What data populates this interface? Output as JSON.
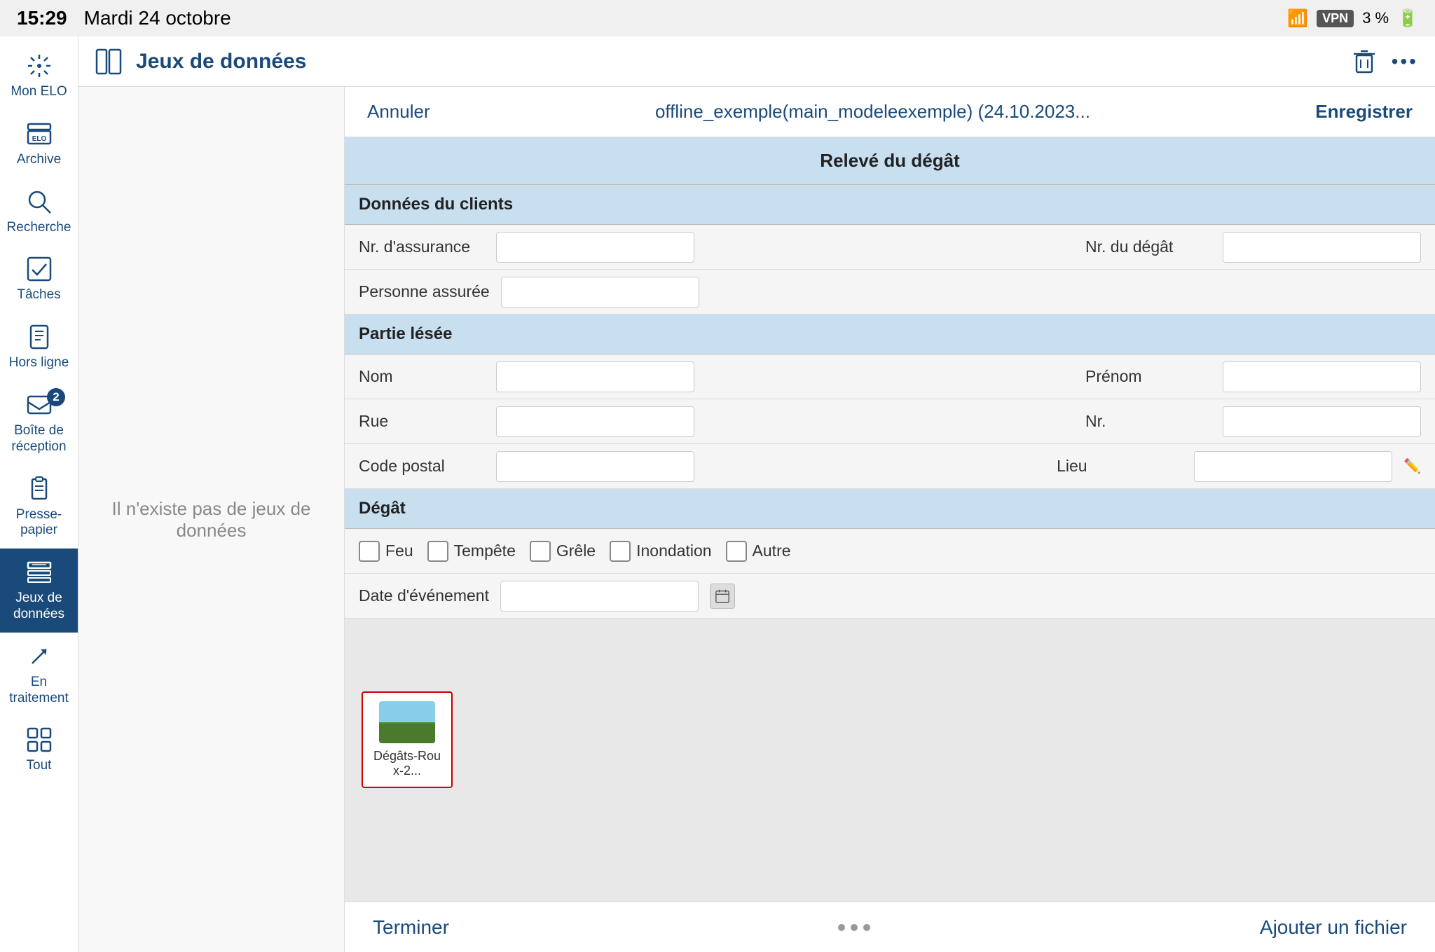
{
  "statusBar": {
    "time": "15:29",
    "date": "Mardi 24 octobre",
    "vpn": "VPN",
    "battery": "3 %"
  },
  "sidebar": {
    "items": [
      {
        "id": "mon-elo",
        "label": "Mon ELO",
        "active": false,
        "badge": null
      },
      {
        "id": "archive",
        "label": "Archive",
        "active": false,
        "badge": null
      },
      {
        "id": "recherche",
        "label": "Recherche",
        "active": false,
        "badge": null
      },
      {
        "id": "taches",
        "label": "Tâches",
        "active": false,
        "badge": null
      },
      {
        "id": "hors-ligne",
        "label": "Hors ligne",
        "active": false,
        "badge": null
      },
      {
        "id": "boite-reception",
        "label": "Boîte de réception",
        "active": false,
        "badge": "2"
      },
      {
        "id": "presse-papier",
        "label": "Presse-papier",
        "active": false,
        "badge": null
      },
      {
        "id": "jeux-donnees",
        "label": "Jeux de données",
        "active": true,
        "badge": null
      },
      {
        "id": "en-traitement",
        "label": "En traitement",
        "active": false,
        "badge": null
      },
      {
        "id": "tout",
        "label": "Tout",
        "active": false,
        "badge": null
      }
    ]
  },
  "toolbar": {
    "title": "Jeux de données",
    "dots": "•••"
  },
  "formHeader": {
    "annuler": "Annuler",
    "title": "offline_exemple(main_modeleexemple) (24.10.2023...",
    "enregistrer": "Enregistrer"
  },
  "form": {
    "mainTitle": "Relevé du dégât",
    "sections": [
      {
        "id": "donnees-clients",
        "label": "Données du clients"
      },
      {
        "id": "partie-lesee",
        "label": "Partie lésée"
      },
      {
        "id": "degat",
        "label": "Dégât"
      }
    ],
    "fields": {
      "nrAssurance": "Nr. d'assurance",
      "nrDegat": "Nr. du dégât",
      "personneAssuree": "Personne assurée",
      "nom": "Nom",
      "prenom": "Prénom",
      "rue": "Rue",
      "nr": "Nr.",
      "codePostal": "Code postal",
      "lieu": "Lieu",
      "dateEvenement": "Date d'événement"
    },
    "checkboxes": [
      "Feu",
      "Tempête",
      "Grêle",
      "Inondation",
      "Autre"
    ]
  },
  "leftPanel": {
    "emptyMessage": "Il n'existe pas de jeux de données"
  },
  "fileArea": {
    "file": {
      "name": "Dégâts-Roux-2...",
      "selected": true
    }
  },
  "bottomBar": {
    "terminer": "Terminer",
    "ajouterFichier": "Ajouter un fichier"
  },
  "centerDots": {
    "label": "···"
  }
}
